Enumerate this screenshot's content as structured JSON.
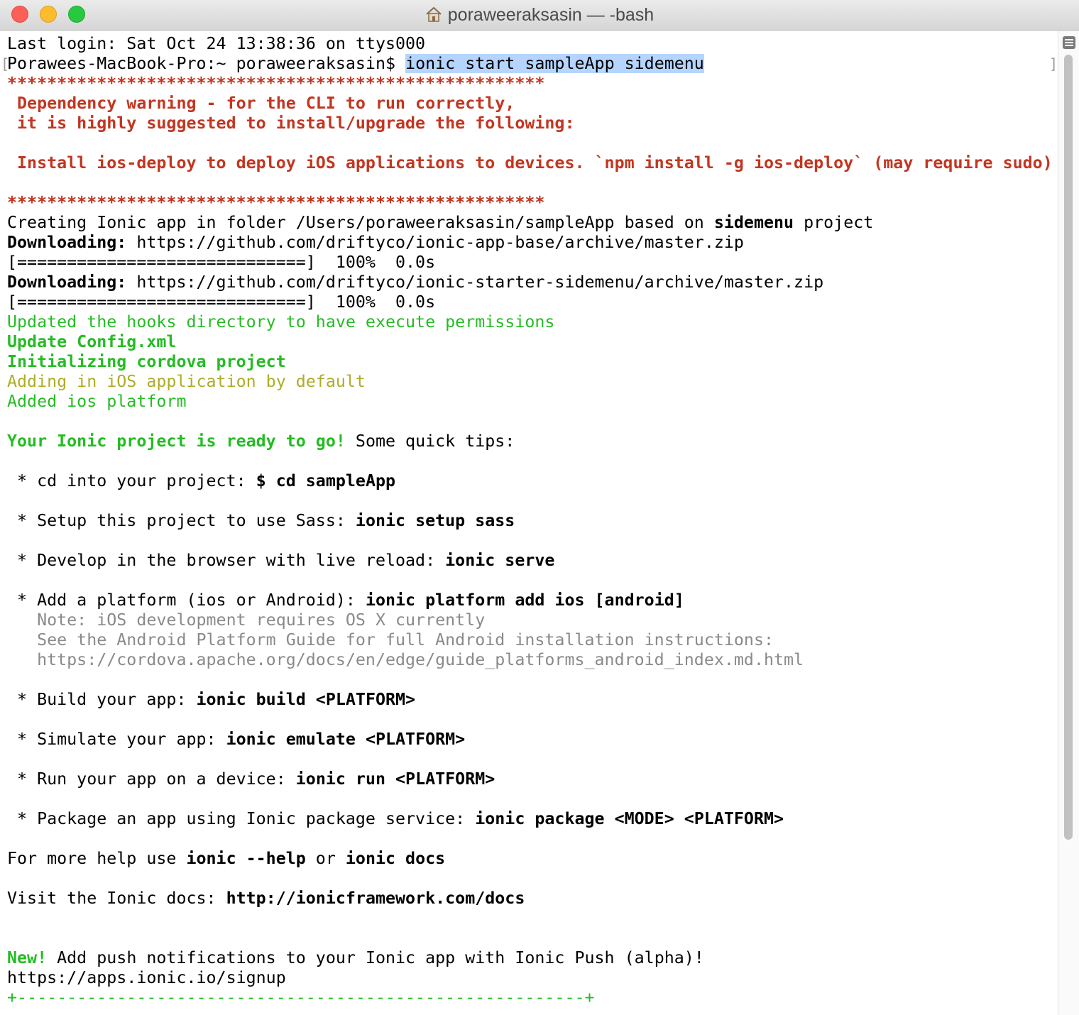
{
  "window": {
    "title": "poraweeraksasin — -bash",
    "controls": [
      "close",
      "minimize",
      "zoom"
    ],
    "title_icon": "home-icon"
  },
  "terminal": {
    "lines": [
      [
        {
          "t": "Last login: Sat Oct 24 13:38:36 on ttys000",
          "c": ""
        }
      ],
      [
        {
          "t": "Porawees-MacBook-Pro:~ poraweeraksasin$ ",
          "c": ""
        },
        {
          "t": "ionic start sampleApp sidemenu",
          "c": "sel"
        }
      ],
      [
        {
          "t": "******************************************************",
          "c": "red"
        }
      ],
      [
        {
          "t": " Dependency warning - for the CLI to run correctly,",
          "c": "red"
        }
      ],
      [
        {
          "t": " it is highly suggested to install/upgrade the following:",
          "c": "red"
        }
      ],
      [],
      [
        {
          "t": " Install ios-deploy to deploy iOS applications to devices. `npm install -g ios-deploy` (may require sudo)",
          "c": "red"
        }
      ],
      [],
      [
        {
          "t": "******************************************************",
          "c": "red"
        }
      ],
      [
        {
          "t": "Creating Ionic app in folder /Users/poraweeraksasin/sampleApp based on ",
          "c": ""
        },
        {
          "t": "sidemenu",
          "c": "b"
        },
        {
          "t": " project",
          "c": ""
        }
      ],
      [
        {
          "t": "Downloading:",
          "c": "b"
        },
        {
          "t": " https://github.com/driftyco/ionic-app-base/archive/master.zip",
          "c": ""
        }
      ],
      [
        {
          "t": "[=============================]  100%  0.0s",
          "c": ""
        }
      ],
      [
        {
          "t": "Downloading:",
          "c": "b"
        },
        {
          "t": " https://github.com/driftyco/ionic-starter-sidemenu/archive/master.zip",
          "c": ""
        }
      ],
      [
        {
          "t": "[=============================]  100%  0.0s",
          "c": ""
        }
      ],
      [
        {
          "t": "Updated the hooks directory to have execute permissions",
          "c": "green"
        }
      ],
      [
        {
          "t": "Update Config.xml",
          "c": "greenb"
        }
      ],
      [
        {
          "t": "Initializing cordova project",
          "c": "greenb"
        }
      ],
      [
        {
          "t": "Adding in iOS application by default",
          "c": "olive"
        }
      ],
      [
        {
          "t": "Added ios platform",
          "c": "green"
        }
      ],
      [],
      [
        {
          "t": "Your Ionic project is ready to go!",
          "c": "greenb"
        },
        {
          "t": " Some quick tips:",
          "c": ""
        }
      ],
      [],
      [
        {
          "t": " * cd into your project: ",
          "c": ""
        },
        {
          "t": "$ cd sampleApp",
          "c": "b"
        }
      ],
      [],
      [
        {
          "t": " * Setup this project to use Sass: ",
          "c": ""
        },
        {
          "t": "ionic setup sass",
          "c": "b"
        }
      ],
      [],
      [
        {
          "t": " * Develop in the browser with live reload: ",
          "c": ""
        },
        {
          "t": "ionic serve",
          "c": "b"
        }
      ],
      [],
      [
        {
          "t": " * Add a platform (ios or Android): ",
          "c": ""
        },
        {
          "t": "ionic platform add ios [android]",
          "c": "b"
        }
      ],
      [
        {
          "t": "   Note: iOS development requires OS X currently",
          "c": "gray"
        }
      ],
      [
        {
          "t": "   See the Android Platform Guide for full Android installation instructions:",
          "c": "gray"
        }
      ],
      [
        {
          "t": "   https://cordova.apache.org/docs/en/edge/guide_platforms_android_index.md.html",
          "c": "gray"
        }
      ],
      [],
      [
        {
          "t": " * Build your app: ",
          "c": ""
        },
        {
          "t": "ionic build <PLATFORM>",
          "c": "b"
        }
      ],
      [],
      [
        {
          "t": " * Simulate your app: ",
          "c": ""
        },
        {
          "t": "ionic emulate <PLATFORM>",
          "c": "b"
        }
      ],
      [],
      [
        {
          "t": " * Run your app on a device: ",
          "c": ""
        },
        {
          "t": "ionic run <PLATFORM>",
          "c": "b"
        }
      ],
      [],
      [
        {
          "t": " * Package an app using Ionic package service: ",
          "c": ""
        },
        {
          "t": "ionic package <MODE> <PLATFORM>",
          "c": "b"
        }
      ],
      [],
      [
        {
          "t": "For more help use ",
          "c": ""
        },
        {
          "t": "ionic --help",
          "c": "b"
        },
        {
          "t": " or ",
          "c": ""
        },
        {
          "t": "ionic docs",
          "c": "b"
        }
      ],
      [],
      [
        {
          "t": "Visit the Ionic docs: ",
          "c": ""
        },
        {
          "t": "http://ionicframework.com/docs",
          "c": "b"
        }
      ],
      [],
      [],
      [
        {
          "t": "New!",
          "c": "greenb"
        },
        {
          "t": " Add push notifications to your Ionic app with Ionic Push (alpha)!",
          "c": ""
        }
      ],
      [
        {
          "t": "https://apps.ionic.io/signup",
          "c": ""
        }
      ],
      [
        {
          "t": "+---------------------------------------------------------+",
          "c": "green"
        }
      ]
    ]
  },
  "colors": {
    "error_red": "#c23621",
    "success_green": "#25bc24",
    "info_olive": "#adad27",
    "note_gray": "#8a8a8a",
    "selection_blue": "#b5d5fe"
  }
}
